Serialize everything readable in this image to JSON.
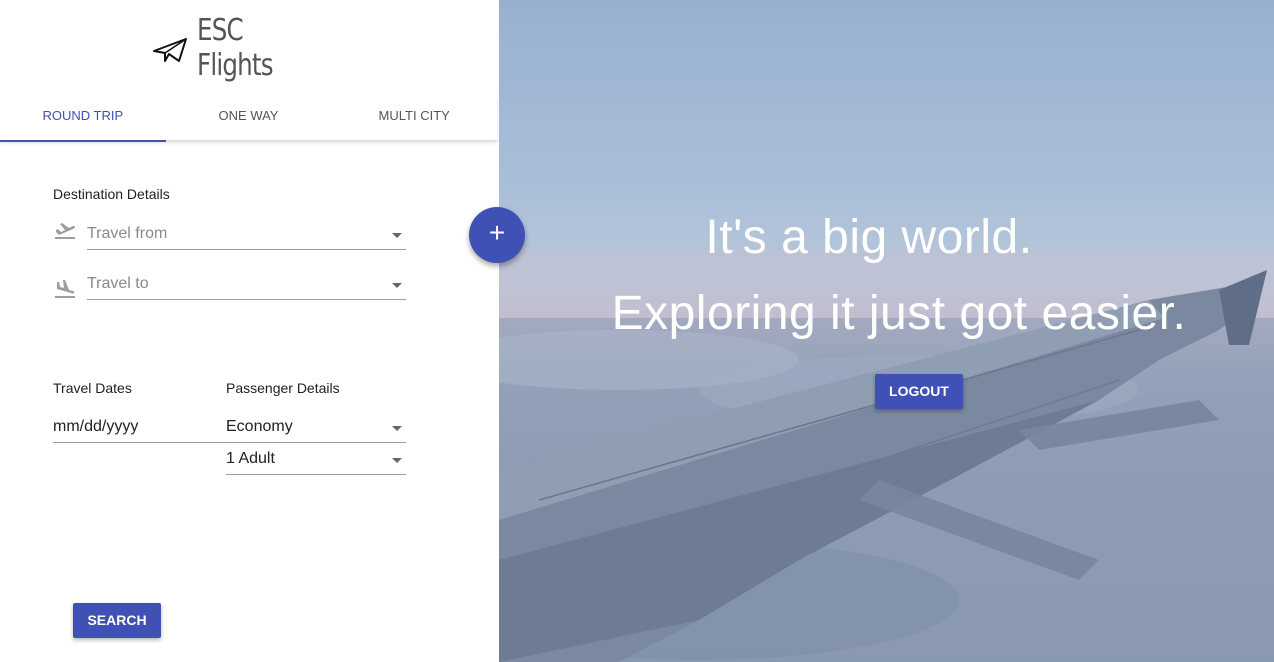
{
  "brand": {
    "name": "ESC Flights",
    "icon": "paper-plane-icon"
  },
  "tabs": [
    {
      "label": "ROUND TRIP",
      "active": true
    },
    {
      "label": "ONE WAY",
      "active": false
    },
    {
      "label": "MULTI CITY",
      "active": false
    }
  ],
  "destination": {
    "section_label": "Destination Details",
    "from": {
      "placeholder": "Travel from",
      "icon": "flight-takeoff-icon"
    },
    "to": {
      "placeholder": "Travel to",
      "icon": "flight-land-icon"
    }
  },
  "dates": {
    "section_label": "Travel Dates",
    "value": "mm/dd/yyyy"
  },
  "passengers": {
    "section_label": "Passenger Details",
    "cabin": "Economy",
    "count": "1 Adult"
  },
  "actions": {
    "search_label": "SEARCH",
    "add_label": "+",
    "logout_label": "LOGOUT"
  },
  "hero": {
    "line1": "It's a big world.",
    "line2": "Exploring it just got easier."
  },
  "colors": {
    "accent": "#3f51b5"
  }
}
